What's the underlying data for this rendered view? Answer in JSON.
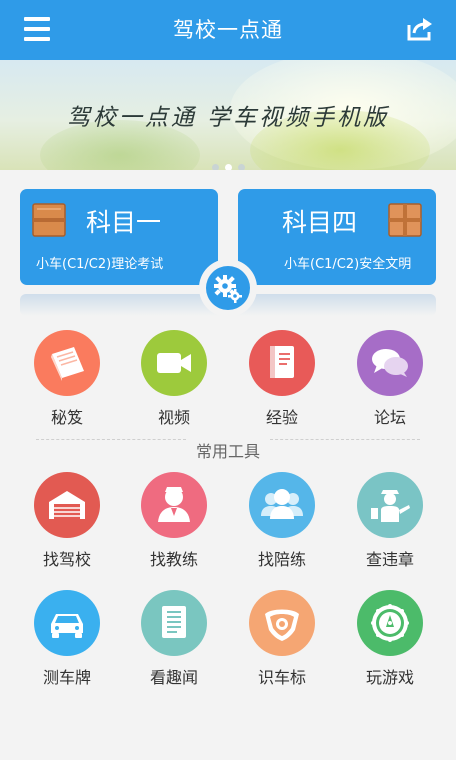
{
  "header": {
    "title": "驾校一点通"
  },
  "banner": {
    "text": "驾校一点通   学车视频手机版",
    "slides": 3,
    "active_slide": 2
  },
  "subjects": [
    {
      "name": "科目一",
      "subtitle": "小车(C1/C2)理论考试"
    },
    {
      "name": "科目四",
      "subtitle": "小车(C1/C2)安全文明"
    }
  ],
  "main_grid": [
    {
      "label": "秘笈",
      "icon": "book-icon",
      "color": "#fa7b5e"
    },
    {
      "label": "视频",
      "icon": "video-camera-icon",
      "color": "#9dca3c"
    },
    {
      "label": "经验",
      "icon": "notebook-icon",
      "color": "#e85a58"
    },
    {
      "label": "论坛",
      "icon": "chat-bubbles-icon",
      "color": "#a66dc7"
    }
  ],
  "tools": {
    "title": "常用工具",
    "items": [
      {
        "label": "找驾校",
        "icon": "garage-icon",
        "color": "#e25a52"
      },
      {
        "label": "找教练",
        "icon": "instructor-icon",
        "color": "#ef6b80"
      },
      {
        "label": "找陪练",
        "icon": "group-icon",
        "color": "#55b6e9"
      },
      {
        "label": "查违章",
        "icon": "traffic-police-icon",
        "color": "#7ac4c5"
      },
      {
        "label": "测车牌",
        "icon": "car-icon",
        "color": "#3ab0ef"
      },
      {
        "label": "看趣闻",
        "icon": "document-icon",
        "color": "#7ac6c0"
      },
      {
        "label": "识车标",
        "icon": "car-badge-icon",
        "color": "#f5a673"
      },
      {
        "label": "玩游戏",
        "icon": "game-wheel-icon",
        "color": "#4cbb6a"
      }
    ]
  }
}
